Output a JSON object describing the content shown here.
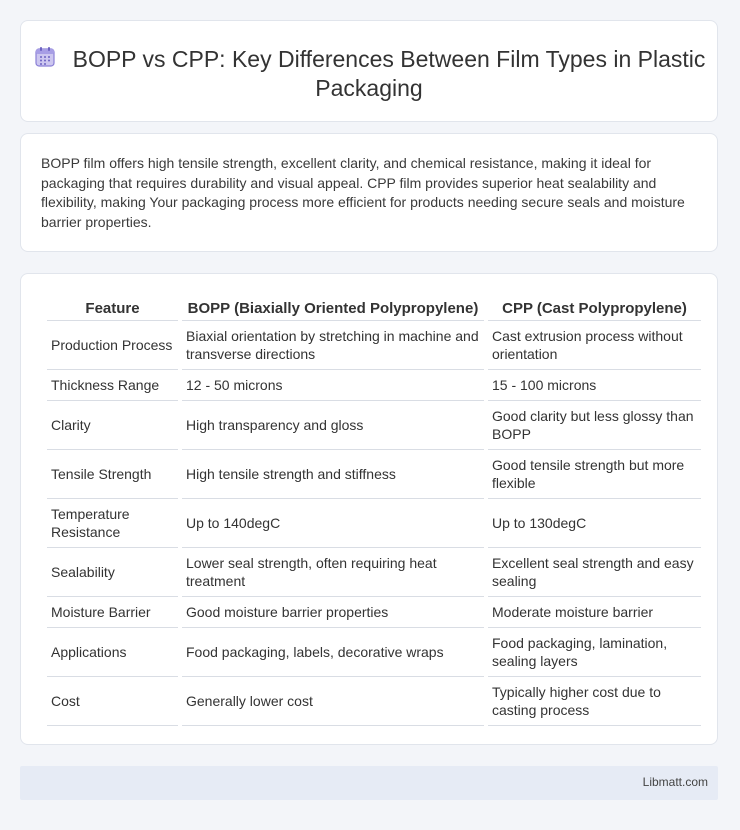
{
  "header": {
    "title": "BOPP vs CPP: Key Differences Between Film Types in Plastic Packaging",
    "icon": "calendar-grid-icon",
    "icon_color": "#8a7fd6"
  },
  "description": "BOPP film offers high tensile strength, excellent clarity, and chemical resistance, making it ideal for packaging that requires durability and visual appeal. CPP film provides superior heat sealability and flexibility, making Your packaging process more efficient for products needing secure seals and moisture barrier properties.",
  "table": {
    "headers": [
      "Feature",
      "BOPP (Biaxially Oriented Polypropylene)",
      "CPP (Cast Polypropylene)"
    ],
    "rows": [
      [
        "Production Process",
        "Biaxial orientation by stretching in machine and transverse directions",
        "Cast extrusion process without orientation"
      ],
      [
        "Thickness Range",
        "12 - 50 microns",
        "15 - 100 microns"
      ],
      [
        "Clarity",
        "High transparency and gloss",
        "Good clarity but less glossy than BOPP"
      ],
      [
        "Tensile Strength",
        "High tensile strength and stiffness",
        "Good tensile strength but more flexible"
      ],
      [
        "Temperature Resistance",
        "Up to 140degC",
        "Up to 130degC"
      ],
      [
        "Sealability",
        "Lower seal strength, often requiring heat treatment",
        "Excellent seal strength and easy sealing"
      ],
      [
        "Moisture Barrier",
        "Good moisture barrier properties",
        "Moderate moisture barrier"
      ],
      [
        "Applications",
        "Food packaging, labels, decorative wraps",
        "Food packaging, lamination, sealing layers"
      ],
      [
        "Cost",
        "Generally lower cost",
        "Typically higher cost due to casting process"
      ]
    ]
  },
  "footer": {
    "brand": "Libmatt.com"
  }
}
